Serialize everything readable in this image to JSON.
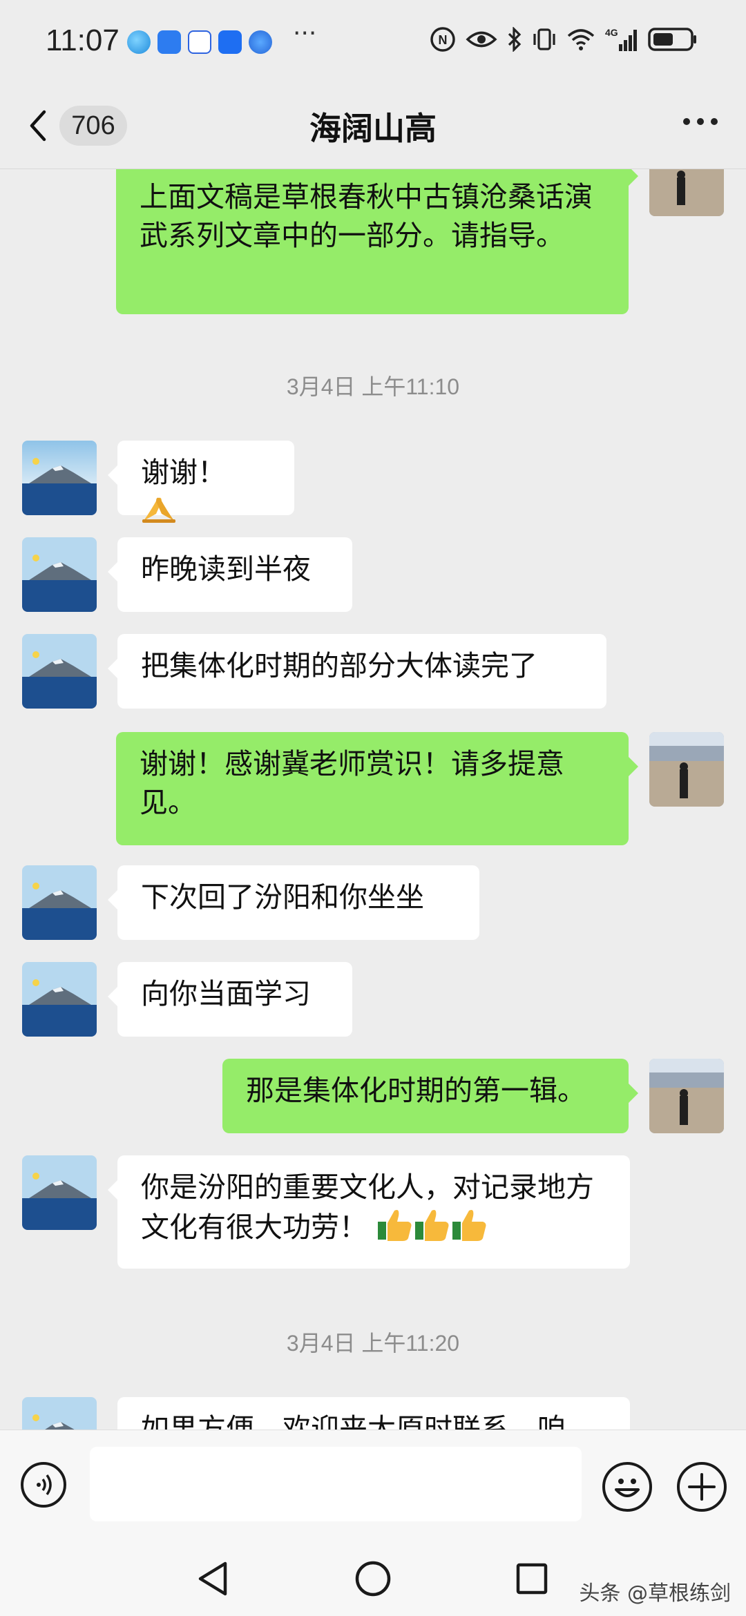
{
  "status_bar": {
    "time": "11:07",
    "more": "···",
    "icons": [
      "app-icon-1",
      "app-icon-2",
      "baidu-icon",
      "app-icon-4",
      "app-icon-5",
      "nfc-icon",
      "eye-icon",
      "bluetooth-icon",
      "vibrate-icon",
      "wifi-icon",
      "signal-4g-icon",
      "battery-icon"
    ],
    "signal_label": "4G"
  },
  "header": {
    "unread_count": "706",
    "title": "海阔山高",
    "more_icon": "more-dots-icon"
  },
  "messages": [
    {
      "side": "right",
      "text": "上面文稿是草根春秋中古镇沧桑话演武系列文章中的一部分。请指导。"
    },
    {
      "type": "time",
      "text": "3月4日 上午11:10"
    },
    {
      "side": "left",
      "text": "谢谢！",
      "emoji": "pray-hands-emoji"
    },
    {
      "side": "left",
      "text": "昨晚读到半夜"
    },
    {
      "side": "left",
      "text": "把集体化时期的部分大体读完了"
    },
    {
      "side": "right",
      "text": "谢谢！感谢冀老师赏识！请多提意见。"
    },
    {
      "side": "left",
      "text": "下次回了汾阳和你坐坐"
    },
    {
      "side": "left",
      "text": "向你当面学习"
    },
    {
      "side": "right",
      "text": "那是集体化时期的第一辑。"
    },
    {
      "side": "left",
      "text": "你是汾阳的重要文化人，对记录地方文化有很大功劳！",
      "emoji": "thumbs-up-emoji x3"
    },
    {
      "type": "time",
      "text": "3月4日 上午11:20"
    },
    {
      "side": "left",
      "text": "如果方便，欢迎来太原时联系，咱"
    }
  ],
  "input_bar": {
    "voice_icon": "voice-icon",
    "emoji_icon": "emoji-face-icon",
    "plus_icon": "plus-icon",
    "input_value": ""
  },
  "system_nav": {
    "back_icon": "nav-back-icon",
    "home_icon": "nav-home-icon",
    "recents_icon": "nav-recents-icon"
  },
  "watermark": "头条 @草根练剑",
  "colors": {
    "background": "#ededed",
    "sent_bubble": "#95ec69",
    "received_bubble": "#ffffff",
    "time_label": "#8c8c8c"
  }
}
